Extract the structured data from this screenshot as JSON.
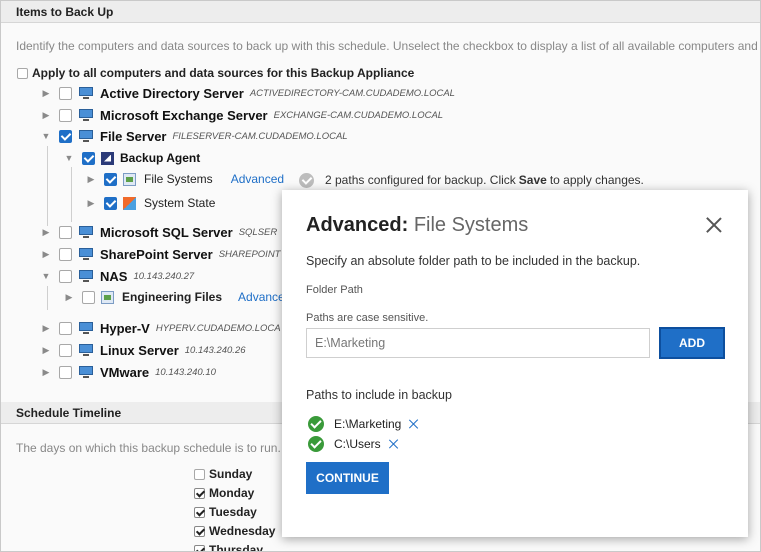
{
  "items_section": {
    "title": "Items to Back Up",
    "description": "Identify the computers and data sources to back up with this schedule. Unselect the checkbox to display a list of all available computers and",
    "apply_all_label": "Apply to all computers and data sources for this Backup Appliance"
  },
  "tree": {
    "active_directory": {
      "name": "Active Directory Server",
      "host": "ACTIVEDIRECTORY-CAM.CUDADEMO.LOCAL"
    },
    "exchange": {
      "name": "Microsoft Exchange Server",
      "host": "EXCHANGE-CAM.CUDADEMO.LOCAL"
    },
    "file_server": {
      "name": "File Server",
      "host": "FILESERVER-CAM.CUDADEMO.LOCAL"
    },
    "backup_agent": {
      "name": "Backup Agent"
    },
    "file_systems": {
      "name": "File Systems",
      "link": "Advanced"
    },
    "system_state": {
      "name": "System State"
    },
    "sql": {
      "name": "Microsoft SQL Server",
      "host": "SQLSER"
    },
    "sharepoint": {
      "name": "SharePoint Server",
      "host": "SHAREPOINT"
    },
    "nas": {
      "name": "NAS",
      "host": "10.143.240.27"
    },
    "engineering": {
      "name": "Engineering Files",
      "link": "Advance"
    },
    "hyperv": {
      "name": "Hyper-V",
      "host": "HYPERV.CUDADEMO.LOCA"
    },
    "linux": {
      "name": "Linux Server",
      "host": "10.143.240.26"
    },
    "vmware": {
      "name": "VMware",
      "host": "10.143.240.10"
    }
  },
  "status": {
    "prefix": "2 paths configured for backup. Click ",
    "bold": "Save",
    "suffix": " to apply changes."
  },
  "schedule_section": {
    "title": "Schedule Timeline",
    "description": "The days on which this backup schedule is to run.",
    "days": [
      {
        "label": "Sunday",
        "checked": false
      },
      {
        "label": "Monday",
        "checked": true
      },
      {
        "label": "Tuesday",
        "checked": true
      },
      {
        "label": "Wednesday",
        "checked": true
      },
      {
        "label": "Thursday",
        "checked": true
      }
    ]
  },
  "modal": {
    "title_bold": "Advanced:",
    "title_rest": "File Systems",
    "instruction": "Specify an absolute folder path to be included in the backup.",
    "folder_path_label": "Folder Path",
    "case_note": "Paths are case sensitive.",
    "input_value": "E:\\Marketing",
    "add_label": "ADD",
    "paths_heading": "Paths to include in backup",
    "paths": [
      "E:\\Marketing",
      "C:\\Users"
    ],
    "continue_label": "CONTINUE"
  },
  "colors": {
    "accent": "#1f6fc7",
    "success": "#3a9a3a"
  }
}
